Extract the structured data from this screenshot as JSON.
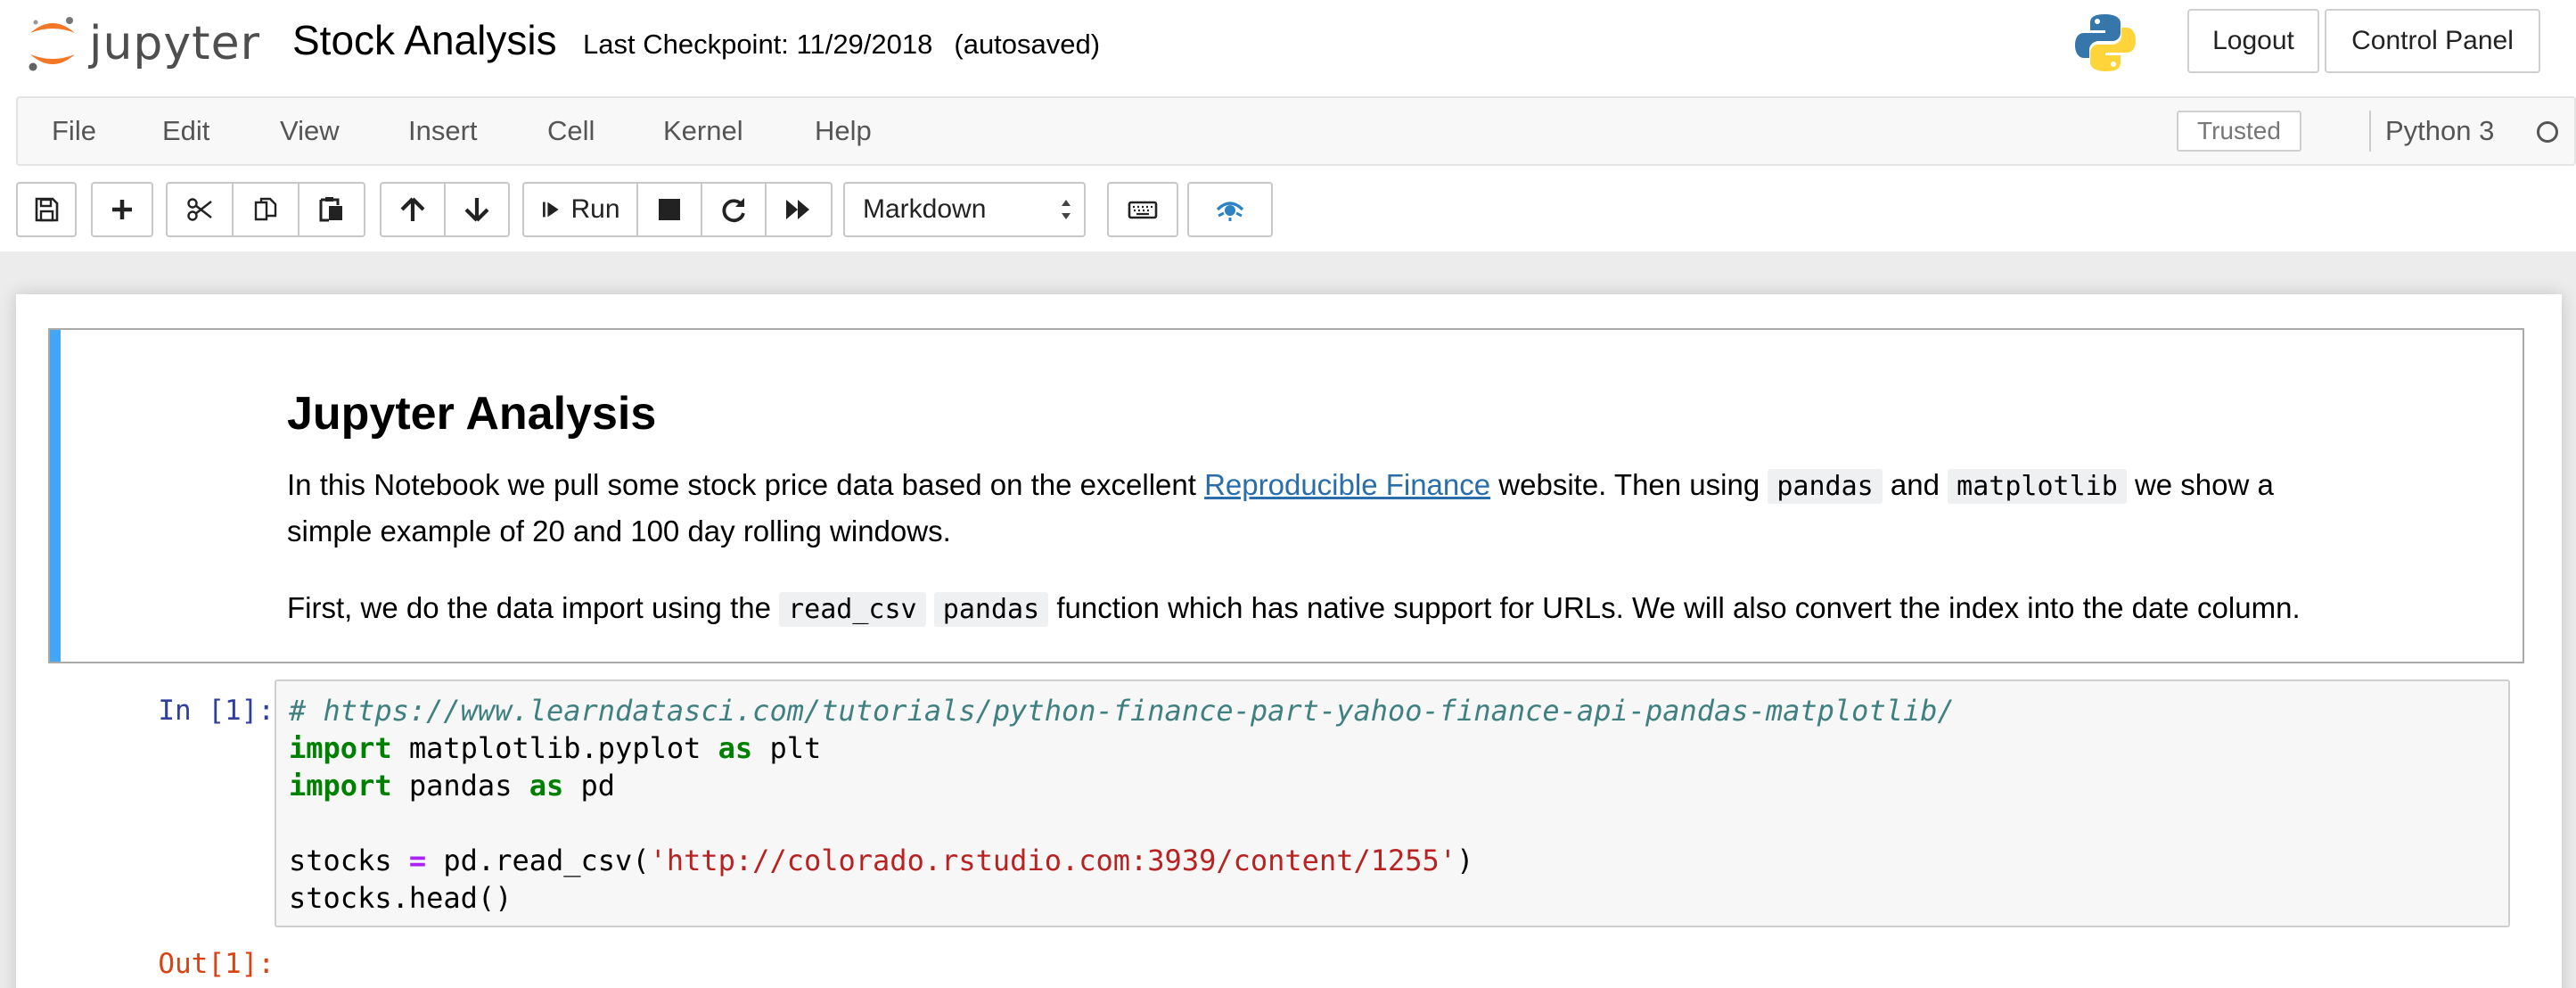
{
  "header": {
    "logo_text": "jupyter",
    "notebook_title": "Stock Analysis",
    "checkpoint": "Last Checkpoint: 11/29/2018",
    "autosave": "(autosaved)",
    "logout_label": "Logout",
    "control_panel_label": "Control Panel"
  },
  "menubar": {
    "items": [
      {
        "label": "File"
      },
      {
        "label": "Edit"
      },
      {
        "label": "View"
      },
      {
        "label": "Insert"
      },
      {
        "label": "Cell"
      },
      {
        "label": "Kernel"
      },
      {
        "label": "Help"
      }
    ],
    "trusted_label": "Trusted",
    "kernel_name": "Python 3"
  },
  "toolbar": {
    "run_label": "Run",
    "cell_type": "Markdown",
    "icons": [
      "save-icon",
      "plus-icon",
      "cut-icon",
      "copy-icon",
      "paste-icon",
      "arrow-up-icon",
      "arrow-down-icon",
      "run-icon",
      "stop-icon",
      "restart-icon",
      "fast-forward-icon",
      "keyboard-icon",
      "command-palette-icon"
    ]
  },
  "markdown_cell": {
    "heading": "Jupyter Analysis",
    "p1_a": "In this Notebook we pull some stock price data based on the excellent ",
    "p1_link": "Reproducible Finance",
    "p1_b": " website. Then using ",
    "p1_code1": "pandas",
    "p1_c": " and ",
    "p1_code2": "matplotlib",
    "p1_d": " we show a",
    "p1_line2": "simple example of 20 and 100 day rolling windows.",
    "p2_a": "First, we do the data import using the ",
    "p2_code1": "read_csv",
    "p2_code2": "pandas",
    "p2_b": " function which has native support for URLs. We will also convert the index into the date column."
  },
  "code_cell": {
    "in_prompt": "In [1]:",
    "out_prompt": "Out[1]:",
    "line1_comment": "# https://www.learndatasci.com/tutorials/python-finance-part-yahoo-finance-api-pandas-matplotlib/",
    "line2_kw": "import",
    "line2_mod": " matplotlib.pyplot ",
    "line2_as": "as",
    "line2_alias": " plt",
    "line3_kw": "import",
    "line3_mod": " pandas ",
    "line3_as": "as",
    "line3_alias": " pd",
    "line5_var": "stocks ",
    "line5_eq": "=",
    "line5_call": " pd.read_csv(",
    "line5_str": "'http://colorado.rstudio.com:3939/content/1255'",
    "line5_close": ")",
    "line6": "stocks.head()"
  },
  "colors": {
    "accent_blue": "#42a5f5",
    "link": "#296eaa",
    "in_prompt": "#303f9f",
    "out_prompt": "#d84315"
  }
}
